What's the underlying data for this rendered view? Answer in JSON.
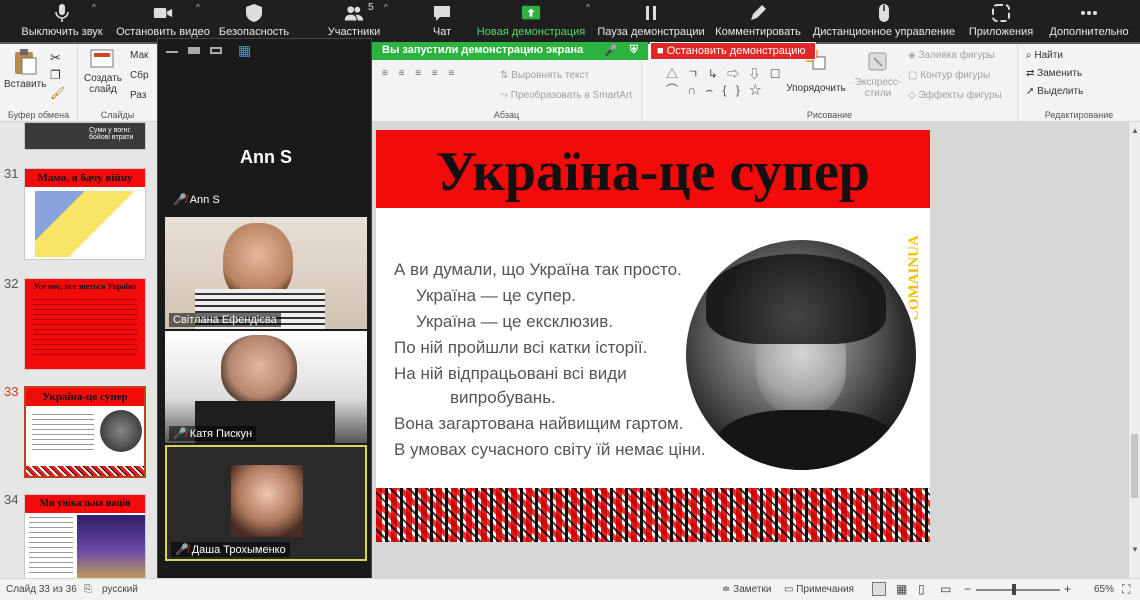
{
  "zoom_toolbar": {
    "mute": "Выключить звук",
    "video": "Остановить видео",
    "security": "Безопасность",
    "participants": "Участники",
    "participants_count": "5",
    "chat": "Чат",
    "new_share": "Новая демонстрация",
    "pause_share": "Пауза демонстрации",
    "annotate": "Комментировать",
    "remote": "Дистанционное управление",
    "apps": "Приложения",
    "more": "Дополнительно"
  },
  "share_banner": {
    "message": "Вы запустили демонстрацию экрана",
    "stop": "Остановить демонстрацию"
  },
  "ribbon": {
    "clipboard": {
      "paste": "Вставить",
      "group": "Буфер обмена"
    },
    "slides": {
      "new_slide_1": "Создать",
      "new_slide_2": "слайд",
      "layout": "Мак",
      "reset": "Сбр",
      "section": "Раз",
      "group": "Слайды"
    },
    "paragraph": {
      "align_text": "Выровнять текст",
      "smartart": "Преобразовать в SmartArt",
      "group": "Абзац"
    },
    "drawing": {
      "arrange": "Упорядочить",
      "express_1": "Экспресс-",
      "express_2": "стили",
      "fill": "Заливка фигуры",
      "outline": "Контур фигуры",
      "effects": "Эффекты фигуры",
      "group": "Рисование"
    },
    "editing": {
      "find": "Найти",
      "replace": "Заменить",
      "select": "Выделить",
      "group": "Редактирование"
    }
  },
  "gallery": {
    "host": {
      "name": "Ann S",
      "label": "Ann S"
    },
    "participants": [
      {
        "name": "Світлана Ефендієва"
      },
      {
        "name": "Катя Пискун"
      },
      {
        "name": "Даша Трохыменко"
      }
    ]
  },
  "slides_panel": {
    "top_caption": "Суми у вогні: бойові втрати",
    "items": [
      {
        "number": "31",
        "title": "Мамо, я бачу війну"
      },
      {
        "number": "32",
        "title": "Усе моє, все зветься Україна"
      },
      {
        "number": "33",
        "title": "Україна-це супер"
      },
      {
        "number": "34",
        "title": "Ми унікальна нація"
      }
    ]
  },
  "slide": {
    "title": "Україна-це супер",
    "brand": "COMAINUA",
    "lines": [
      "А ви думали, що Україна так просто.",
      "Україна — це супер.",
      "Україна — це ексклюзив.",
      "По ній пройшли всі катки історії.",
      "На ній відпрацьовані всі види",
      "випробувань.",
      "Вона загартована найвищим гартом.",
      "В умовах сучасного світу їй немає ціни."
    ]
  },
  "status_bar": {
    "slide_count": "Слайд 33 из 36",
    "language": "русский",
    "notes": "Заметки",
    "comments": "Примечания",
    "zoom": "65%"
  },
  "colors": {
    "zoom_bg": "#1f1f1f",
    "share_green": "#2cb33f",
    "stop_red": "#e02828",
    "slide_red": "#f30a0a"
  }
}
